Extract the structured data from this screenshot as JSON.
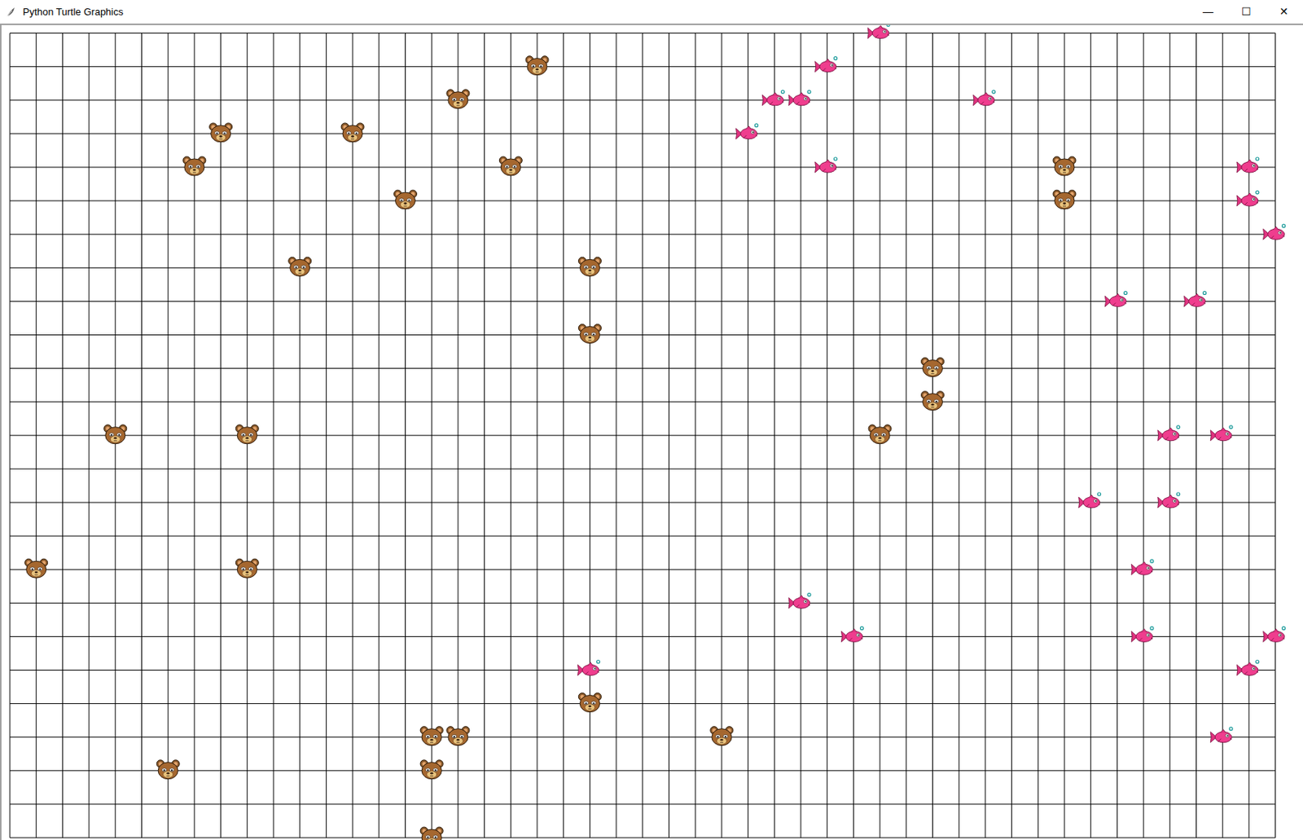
{
  "window": {
    "title": "Python Turtle Graphics",
    "controls": [
      "—",
      "☐",
      "✕"
    ]
  },
  "grid": {
    "columns": 48,
    "rows": 24
  },
  "animals": [
    {
      "kind": "bear",
      "col": 20,
      "row": 1
    },
    {
      "kind": "bear",
      "col": 17,
      "row": 2
    },
    {
      "kind": "bear",
      "col": 8,
      "row": 3
    },
    {
      "kind": "bear",
      "col": 13,
      "row": 3
    },
    {
      "kind": "bear",
      "col": 7,
      "row": 4
    },
    {
      "kind": "bear",
      "col": 19,
      "row": 4
    },
    {
      "kind": "bear",
      "col": 15,
      "row": 5
    },
    {
      "kind": "bear",
      "col": 11,
      "row": 7
    },
    {
      "kind": "bear",
      "col": 22,
      "row": 7
    },
    {
      "kind": "bear",
      "col": 22,
      "row": 9
    },
    {
      "kind": "bear",
      "col": 35,
      "row": 10
    },
    {
      "kind": "bear",
      "col": 35,
      "row": 11
    },
    {
      "kind": "bear",
      "col": 4,
      "row": 12
    },
    {
      "kind": "bear",
      "col": 9,
      "row": 12
    },
    {
      "kind": "bear",
      "col": 33,
      "row": 12
    },
    {
      "kind": "bear",
      "col": 40,
      "row": 4
    },
    {
      "kind": "bear",
      "col": 40,
      "row": 5
    },
    {
      "kind": "bear",
      "col": 1,
      "row": 16
    },
    {
      "kind": "bear",
      "col": 9,
      "row": 16
    },
    {
      "kind": "bear",
      "col": 22,
      "row": 20
    },
    {
      "kind": "bear",
      "col": 16,
      "row": 21
    },
    {
      "kind": "bear",
      "col": 17,
      "row": 21
    },
    {
      "kind": "bear",
      "col": 27,
      "row": 21
    },
    {
      "kind": "bear",
      "col": 6,
      "row": 22
    },
    {
      "kind": "bear",
      "col": 16,
      "row": 22
    },
    {
      "kind": "bear",
      "col": 16,
      "row": 24
    },
    {
      "kind": "fish",
      "col": 33,
      "row": 0
    },
    {
      "kind": "fish",
      "col": 31,
      "row": 1
    },
    {
      "kind": "fish",
      "col": 29,
      "row": 2
    },
    {
      "kind": "fish",
      "col": 30,
      "row": 2
    },
    {
      "kind": "fish",
      "col": 37,
      "row": 2
    },
    {
      "kind": "fish",
      "col": 28,
      "row": 3
    },
    {
      "kind": "fish",
      "col": 31,
      "row": 4
    },
    {
      "kind": "fish",
      "col": 47,
      "row": 4
    },
    {
      "kind": "fish",
      "col": 47,
      "row": 5
    },
    {
      "kind": "fish",
      "col": 48,
      "row": 6
    },
    {
      "kind": "fish",
      "col": 42,
      "row": 8
    },
    {
      "kind": "fish",
      "col": 45,
      "row": 8
    },
    {
      "kind": "fish",
      "col": 44,
      "row": 12
    },
    {
      "kind": "fish",
      "col": 46,
      "row": 12
    },
    {
      "kind": "fish",
      "col": 41,
      "row": 14
    },
    {
      "kind": "fish",
      "col": 44,
      "row": 14
    },
    {
      "kind": "fish",
      "col": 43,
      "row": 16
    },
    {
      "kind": "fish",
      "col": 30,
      "row": 17
    },
    {
      "kind": "fish",
      "col": 32,
      "row": 18
    },
    {
      "kind": "fish",
      "col": 43,
      "row": 18
    },
    {
      "kind": "fish",
      "col": 48,
      "row": 18
    },
    {
      "kind": "fish",
      "col": 47,
      "row": 19
    },
    {
      "kind": "fish",
      "col": 22,
      "row": 19
    },
    {
      "kind": "fish",
      "col": 46,
      "row": 21
    }
  ]
}
